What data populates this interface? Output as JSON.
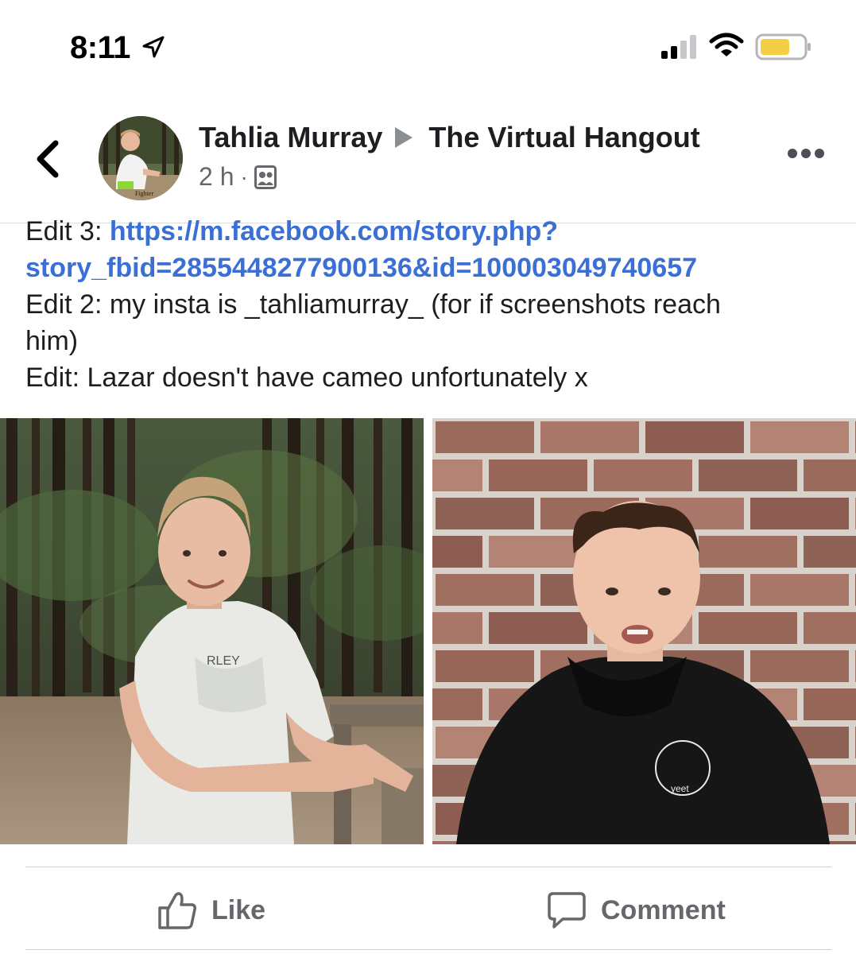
{
  "status_bar": {
    "time": "8:11",
    "icons": [
      "location-arrow-icon",
      "signal-icon",
      "wifi-icon",
      "battery-icon"
    ]
  },
  "header": {
    "author": "Tahlia Murray",
    "group": "The Virtual Hangout",
    "time_ago": "2 h",
    "dot": "·",
    "audience_icon": "group-audience-icon"
  },
  "post": {
    "edit3_label": "Edit 3: ",
    "edit3_link_part1": "https://m.facebook.com/story.php?",
    "edit3_link_part2": "story_fbid=2855448277900136&id=100003049740657",
    "edit2_line1": "Edit 2: my insta is _tahliamurray_ (for if screenshots reach",
    "edit2_line2": "him)",
    "edit1": "Edit: Lazar doesn't have cameo unfortunately x"
  },
  "photos": {
    "left_shirt_print": "RLEY",
    "right_hoodie_print": "yeet"
  },
  "actions": {
    "like": "Like",
    "comment": "Comment"
  },
  "colors": {
    "link": "#3a6fd6",
    "secondary_text": "#65676b",
    "battery_fill": "#f4cf46"
  }
}
